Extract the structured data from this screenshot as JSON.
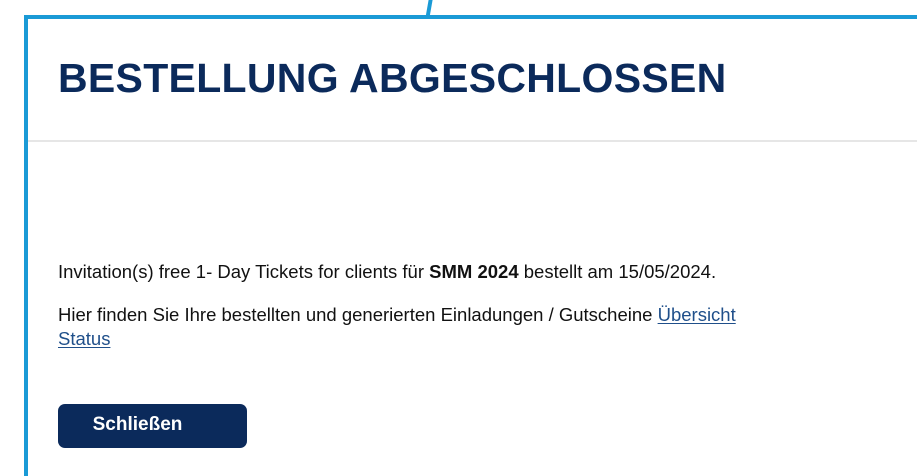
{
  "dialog": {
    "title": "BESTELLUNG ABGESCHLOSSEN",
    "message1": {
      "prefix": "Invitation(s) free 1- Day Tickets for clients für ",
      "event": "SMM 2024",
      "suffix": " bestellt am 15/05/2024."
    },
    "message2": {
      "prefix": "Hier finden Sie Ihre bestellten und generierten Einladungen / Gutscheine ",
      "link_label_line1": "Übersicht",
      "link_label_line2": "Status"
    },
    "close_label": "Schließen"
  },
  "colors": {
    "accent_border": "#1a9ad6",
    "title_navy": "#0b2a5b",
    "link_blue": "#1f4f8a",
    "button_navy": "#0b2a5b"
  }
}
